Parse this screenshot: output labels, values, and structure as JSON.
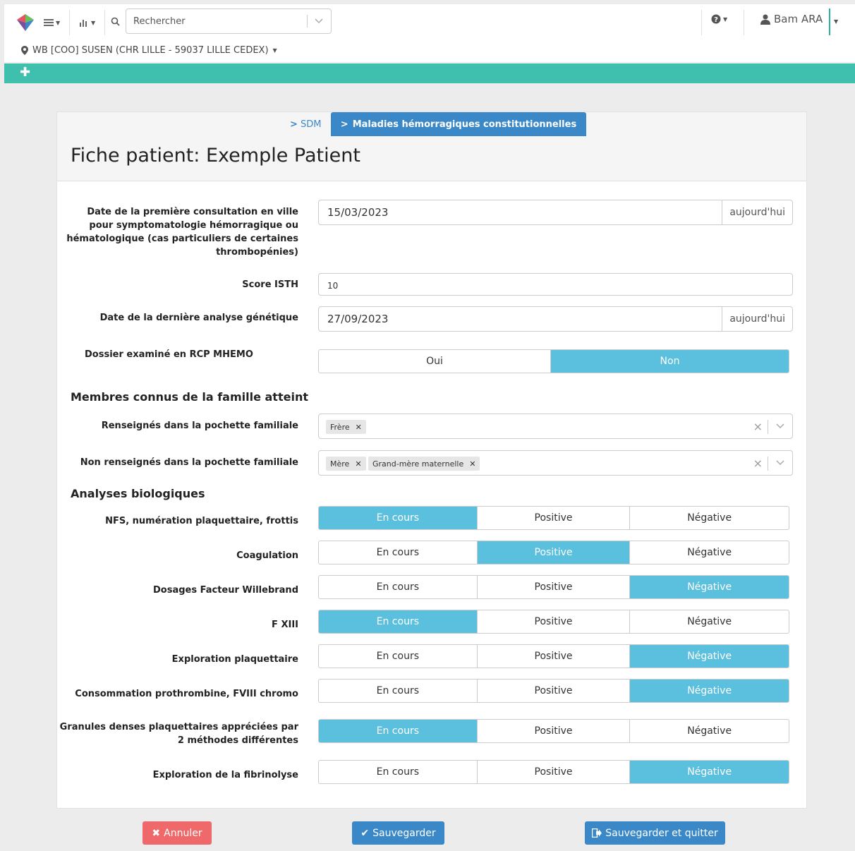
{
  "topbar": {
    "search_placeholder": "Rechercher",
    "user_name": "Bam ARA",
    "location": "WB [COO] SUSEN (CHR LILLE - 59037 LILLE CEDEX)"
  },
  "tabs": {
    "sdm": "SDM",
    "active": "Maladies hémorragiques constitutionnelles"
  },
  "page_title": "Fiche patient: Exemple Patient",
  "fields": {
    "first_consult_label": "Date de la première consultation en ville pour symptomatologie hémorragique ou hématologique (cas particuliers de certaines thrombopénies)",
    "first_consult_value": "15/03/2023",
    "today_label": "aujourd'hui",
    "isth_label": "Score ISTH",
    "isth_value": "10",
    "genetic_label": "Date de la dernière analyse génétique",
    "genetic_value": "27/09/2023",
    "rcp_label": "Dossier examiné en RCP MHEMO",
    "rcp_yes": "Oui",
    "rcp_no": "Non",
    "rcp_selected": "Non"
  },
  "family": {
    "section_title": "Membres connus de la famille atteint",
    "in_pouch_label": "Renseignés dans la pochette familiale",
    "in_pouch_tags": [
      "Frère"
    ],
    "not_in_pouch_label": "Non renseignés dans la pochette familiale",
    "not_in_pouch_tags": [
      "Mère",
      "Grand-mère maternelle"
    ]
  },
  "bio": {
    "section_title": "Analyses biologiques",
    "options": [
      "En cours",
      "Positive",
      "Négative"
    ],
    "rows": [
      {
        "label": "NFS, numération plaquettaire, frottis",
        "selected": 0
      },
      {
        "label": "Coagulation",
        "selected": 1
      },
      {
        "label": "Dosages Facteur Willebrand",
        "selected": 2
      },
      {
        "label": "F XIII",
        "selected": 0
      },
      {
        "label": "Exploration plaquettaire",
        "selected": 2
      },
      {
        "label": "Consommation prothrombine, FVIII chromo",
        "selected": 2
      },
      {
        "label": "Granules denses plaquettaires appréciées par 2 méthodes différentes",
        "selected": 0
      },
      {
        "label": "Exploration de la fibrinolyse",
        "selected": 2
      }
    ]
  },
  "buttons": {
    "cancel": "Annuler",
    "save": "Sauvegarder",
    "save_quit": "Sauvegarder et quitter"
  },
  "colors": {
    "teal": "#3fbfae",
    "primary": "#3a88c8",
    "selected": "#5bc0de",
    "danger": "#f0696a"
  }
}
